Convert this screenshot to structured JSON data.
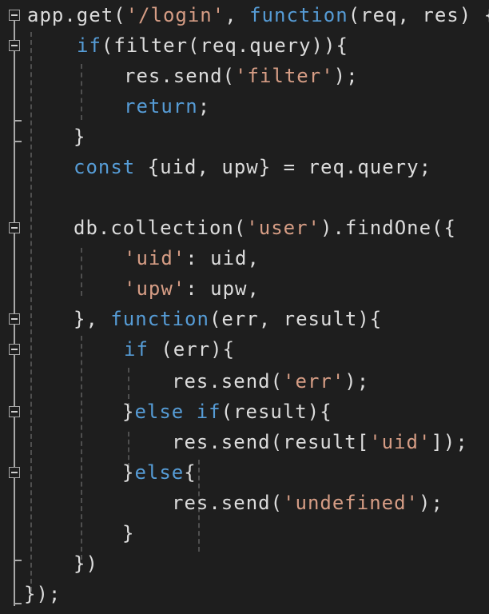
{
  "editor": {
    "colors": {
      "background": "#1e1e1e",
      "plain": "#dcdcdc",
      "keyword": "#569cd6",
      "string": "#d69d85",
      "gutter": "#a9a9a9",
      "indent_guide": "#4f4f4f"
    },
    "icons": {
      "fold_toggle": "collapse-minus-icon"
    },
    "lines": [
      {
        "tokens": [
          {
            "t": "app.get(",
            "c": "plain"
          },
          {
            "t": "'/login'",
            "c": "str"
          },
          {
            "t": ", ",
            "c": "plain"
          },
          {
            "t": "function",
            "c": "kw"
          },
          {
            "t": "(req, res) {",
            "c": "plain"
          }
        ]
      },
      {
        "tokens": [
          {
            "t": "if",
            "c": "kw"
          },
          {
            "t": "(filter(req.query)){",
            "c": "plain"
          }
        ]
      },
      {
        "tokens": [
          {
            "t": "res.send(",
            "c": "plain"
          },
          {
            "t": "'filter'",
            "c": "str"
          },
          {
            "t": ");",
            "c": "plain"
          }
        ]
      },
      {
        "tokens": [
          {
            "t": "return",
            "c": "kw"
          },
          {
            "t": ";",
            "c": "plain"
          }
        ]
      },
      {
        "tokens": [
          {
            "t": "}",
            "c": "plain"
          }
        ]
      },
      {
        "tokens": [
          {
            "t": "const",
            "c": "kw"
          },
          {
            "t": " {uid, upw} = req.query;",
            "c": "plain"
          }
        ]
      },
      {
        "tokens": []
      },
      {
        "tokens": [
          {
            "t": "db.collection(",
            "c": "plain"
          },
          {
            "t": "'user'",
            "c": "str"
          },
          {
            "t": ").findOne({",
            "c": "plain"
          }
        ]
      },
      {
        "tokens": [
          {
            "t": "'uid'",
            "c": "str"
          },
          {
            "t": ": uid,",
            "c": "plain"
          }
        ]
      },
      {
        "tokens": [
          {
            "t": "'upw'",
            "c": "str"
          },
          {
            "t": ": upw,",
            "c": "plain"
          }
        ]
      },
      {
        "tokens": [
          {
            "t": "}, ",
            "c": "plain"
          },
          {
            "t": "function",
            "c": "kw"
          },
          {
            "t": "(err, result){",
            "c": "plain"
          }
        ]
      },
      {
        "tokens": [
          {
            "t": "if",
            "c": "kw"
          },
          {
            "t": " (err){",
            "c": "plain"
          }
        ]
      },
      {
        "tokens": [
          {
            "t": "res.send(",
            "c": "plain"
          },
          {
            "t": "'err'",
            "c": "str"
          },
          {
            "t": ");",
            "c": "plain"
          }
        ]
      },
      {
        "tokens": [
          {
            "t": "}",
            "c": "plain"
          },
          {
            "t": "else",
            "c": "kw"
          },
          {
            "t": " ",
            "c": "plain"
          },
          {
            "t": "if",
            "c": "kw"
          },
          {
            "t": "(result){",
            "c": "plain"
          }
        ]
      },
      {
        "tokens": [
          {
            "t": "res.send(result[",
            "c": "plain"
          },
          {
            "t": "'uid'",
            "c": "str"
          },
          {
            "t": "]);",
            "c": "plain"
          }
        ]
      },
      {
        "tokens": [
          {
            "t": "}",
            "c": "plain"
          },
          {
            "t": "else",
            "c": "kw"
          },
          {
            "t": "{",
            "c": "plain"
          }
        ]
      },
      {
        "tokens": [
          {
            "t": "res.send(",
            "c": "plain"
          },
          {
            "t": "'undefined'",
            "c": "str"
          },
          {
            "t": ");",
            "c": "plain"
          }
        ]
      },
      {
        "tokens": [
          {
            "t": "}",
            "c": "plain"
          }
        ]
      },
      {
        "tokens": [
          {
            "t": "})",
            "c": "plain"
          }
        ]
      },
      {
        "tokens": [
          {
            "t": "});",
            "c": "plain"
          }
        ]
      }
    ]
  }
}
